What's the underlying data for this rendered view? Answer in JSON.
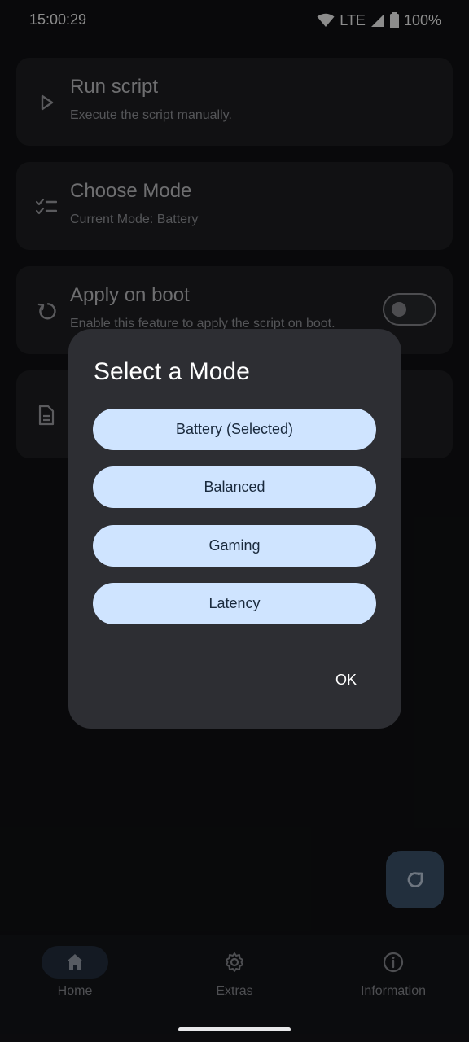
{
  "status_bar": {
    "time": "15:00:29",
    "network": "LTE",
    "battery": "100%"
  },
  "cards": {
    "run_script": {
      "title": "Run script",
      "subtitle": "Execute the script manually.",
      "icon": "play-icon"
    },
    "choose_mode": {
      "title": "Choose Mode",
      "subtitle": "Current Mode: Battery",
      "icon": "checklist-icon"
    },
    "apply_on_boot": {
      "title": "Apply on boot",
      "subtitle": "Enable this feature to apply the script on boot.",
      "icon": "restart-icon",
      "toggle_on": false
    },
    "log": {
      "icon": "document-icon"
    }
  },
  "dialog": {
    "title": "Select a Mode",
    "options": [
      "Battery (Selected)",
      "Balanced",
      "Gaming",
      "Latency"
    ],
    "ok_label": "OK"
  },
  "fab": {
    "icon": "refresh-icon"
  },
  "bottom_nav": {
    "items": [
      {
        "label": "Home",
        "icon": "home-icon",
        "active": true
      },
      {
        "label": "Extras",
        "icon": "gear-icon",
        "active": false
      },
      {
        "label": "Information",
        "icon": "info-icon",
        "active": false
      }
    ]
  },
  "colors": {
    "background": "#111214",
    "card": "#1f2023",
    "dialog": "#2d2e33",
    "option_button": "#cfe4ff",
    "fab": "#3f5670",
    "nav_active_pill": "#253140"
  }
}
